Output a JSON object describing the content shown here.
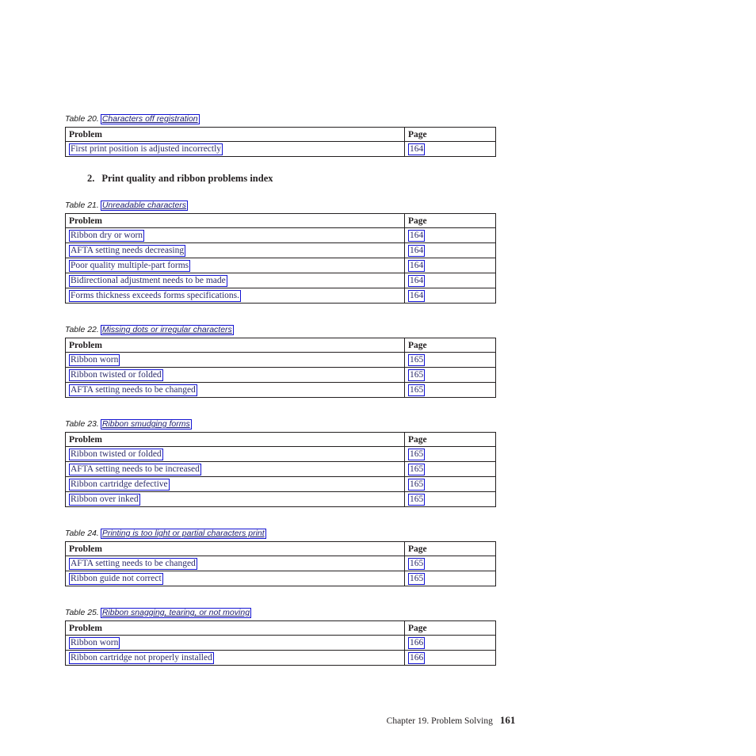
{
  "document": {
    "footer": {
      "chapter_label": "Chapter 19. Problem Solving",
      "page_number": "161"
    },
    "section_heading": {
      "number": "2.",
      "title": "Print quality and ribbon problems index"
    },
    "column_headers": {
      "problem": "Problem",
      "page": "Page"
    },
    "tables": [
      {
        "caption_number": "Table 20.",
        "caption_title": "Characters off registration",
        "rows": [
          {
            "problem": "First print position is adjusted incorrectly",
            "page": "164"
          }
        ]
      },
      {
        "caption_number": "Table 21.",
        "caption_title": "Unreadable characters",
        "rows": [
          {
            "problem": "Ribbon dry or worn",
            "page": "164"
          },
          {
            "problem": "AFTA setting needs decreasing",
            "page": "164"
          },
          {
            "problem": "Poor quality multiple-part forms",
            "page": "164"
          },
          {
            "problem": "Bidirectional adjustment needs to be made",
            "page": "164"
          },
          {
            "problem": "Forms thickness exceeds forms specifications.",
            "page": "164"
          }
        ]
      },
      {
        "caption_number": "Table 22.",
        "caption_title": "Missing dots or irregular characters",
        "rows": [
          {
            "problem": "Ribbon worn",
            "page": "165"
          },
          {
            "problem": "Ribbon twisted or folded",
            "page": "165"
          },
          {
            "problem": "AFTA setting needs to be changed",
            "page": "165"
          }
        ]
      },
      {
        "caption_number": "Table 23.",
        "caption_title": "Ribbon smudging forms",
        "rows": [
          {
            "problem": "Ribbon twisted or folded",
            "page": "165"
          },
          {
            "problem": "AFTA setting needs to be increased",
            "page": "165"
          },
          {
            "problem": "Ribbon cartridge defective",
            "page": "165"
          },
          {
            "problem": "Ribbon over inked",
            "page": "165"
          }
        ]
      },
      {
        "caption_number": "Table 24.",
        "caption_title": "Printing is too light or partial characters print",
        "rows": [
          {
            "problem": "AFTA setting needs to be changed",
            "page": "165"
          },
          {
            "problem": "Ribbon guide not correct",
            "page": "165"
          }
        ]
      },
      {
        "caption_number": "Table 25.",
        "caption_title": "Ribbon snagging, tearing, or not moving",
        "rows": [
          {
            "problem": "Ribbon worn",
            "page": "166"
          },
          {
            "problem": "Ribbon cartridge not properly installed",
            "page": "166"
          }
        ]
      }
    ],
    "colors": {
      "link_border": "#1414d2",
      "link_text": "#2b2b6b",
      "table_border": "#231f20",
      "body_text": "#231f20"
    }
  }
}
